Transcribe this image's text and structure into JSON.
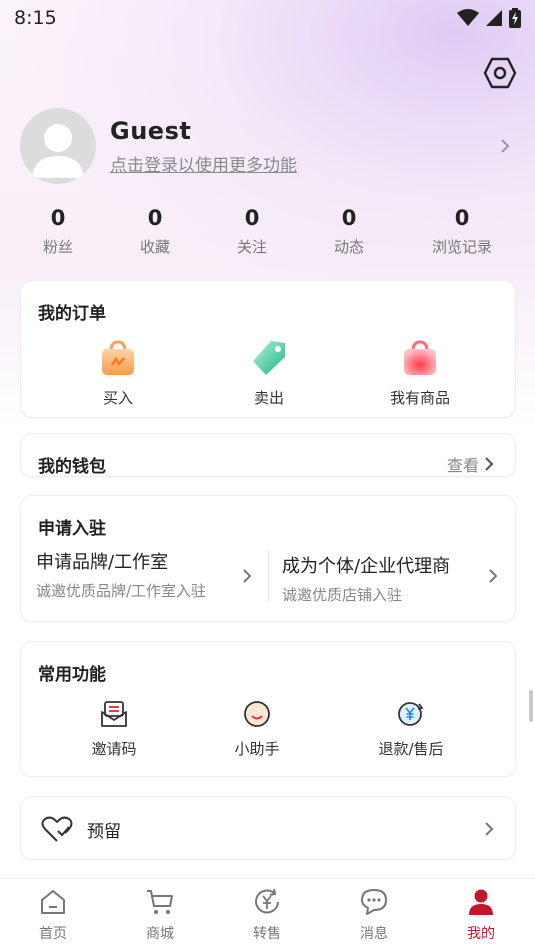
{
  "status_bar": {
    "time": "8:15"
  },
  "profile": {
    "name": "Guest",
    "subtitle": "点击登录以使用更多功能"
  },
  "stats": [
    {
      "value": "0",
      "label": "粉丝"
    },
    {
      "value": "0",
      "label": "收藏"
    },
    {
      "value": "0",
      "label": "关注"
    },
    {
      "value": "0",
      "label": "动态"
    },
    {
      "value": "0",
      "label": "浏览记录"
    }
  ],
  "orders": {
    "title": "我的订单",
    "items": [
      {
        "label": "买入"
      },
      {
        "label": "卖出"
      },
      {
        "label": "我有商品"
      }
    ]
  },
  "wallet": {
    "title": "我的钱包",
    "more": "查看"
  },
  "apply": {
    "title": "申请入驻",
    "items": [
      {
        "main": "申请品牌/工作室",
        "sub": "诚邀优质品牌/工作室入驻"
      },
      {
        "main": "成为个体/企业代理商",
        "sub": "诚邀优质店铺入驻"
      }
    ]
  },
  "functions": {
    "title": "常用功能",
    "items": [
      {
        "label": "邀请码"
      },
      {
        "label": "小助手"
      },
      {
        "label": "退款/售后"
      }
    ]
  },
  "reserve": {
    "label": "预留"
  },
  "tabbar": {
    "items": [
      {
        "label": "首页"
      },
      {
        "label": "商城"
      },
      {
        "label": "转售"
      },
      {
        "label": "消息"
      },
      {
        "label": "我的"
      }
    ],
    "active_color": "#c0172b"
  }
}
